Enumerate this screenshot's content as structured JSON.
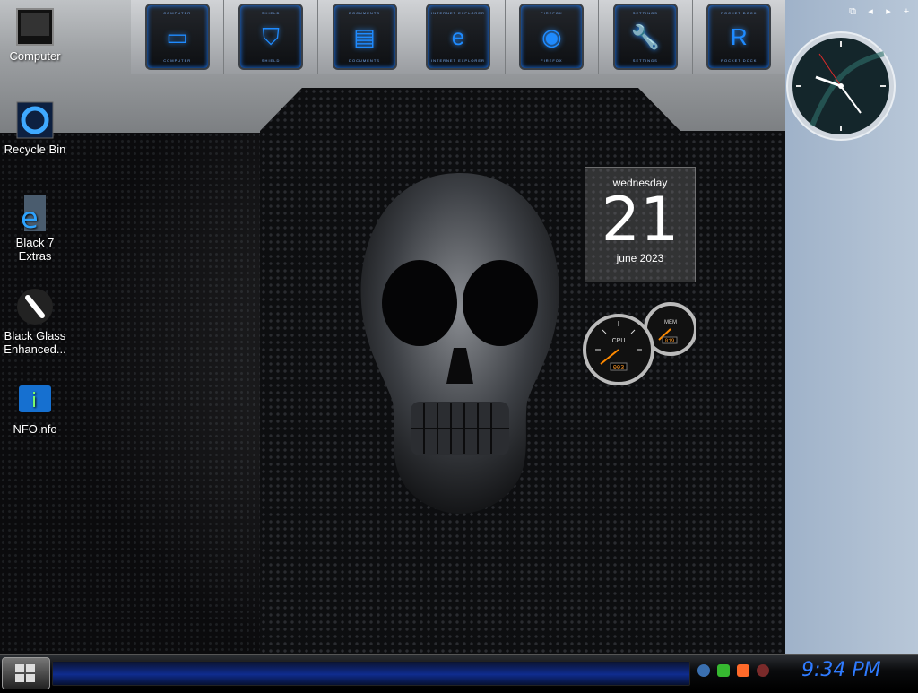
{
  "desktop": {
    "icons": [
      {
        "label": "Computer"
      },
      {
        "label": "Recycle Bin"
      },
      {
        "label": "Black 7\nExtras"
      },
      {
        "label": "Black Glass\nEnhanced..."
      },
      {
        "label": "NFO.nfo"
      }
    ]
  },
  "dock": {
    "items": [
      {
        "label": "COMPUTER",
        "icon": "monitor-icon",
        "glyph": "▭"
      },
      {
        "label": "SHIELD",
        "icon": "shield-icon",
        "glyph": "⛉"
      },
      {
        "label": "DOCUMENTS",
        "icon": "folder-icon",
        "glyph": "▤"
      },
      {
        "label": "INTERNET EXPLORER",
        "icon": "ie-icon",
        "glyph": "e"
      },
      {
        "label": "FIREFOX",
        "icon": "firefox-icon",
        "glyph": "◉"
      },
      {
        "label": "SETTINGS",
        "icon": "wrench-icon",
        "glyph": "🔧"
      },
      {
        "label": "ROCKET DOCK",
        "icon": "rocket-icon",
        "glyph": "R"
      }
    ]
  },
  "calendar_gadget": {
    "day_of_week": "wednesday",
    "day": "21",
    "month_year": "june 2023"
  },
  "cpu_meter": {
    "cpu_label": "CPU",
    "mem_label": "MEM",
    "cpu_readout": "003",
    "mem_readout": "019"
  },
  "taskbar": {
    "time": "9:34 PM"
  },
  "colors": {
    "accent": "#2f7bff",
    "sidebar": "#aebed2"
  }
}
